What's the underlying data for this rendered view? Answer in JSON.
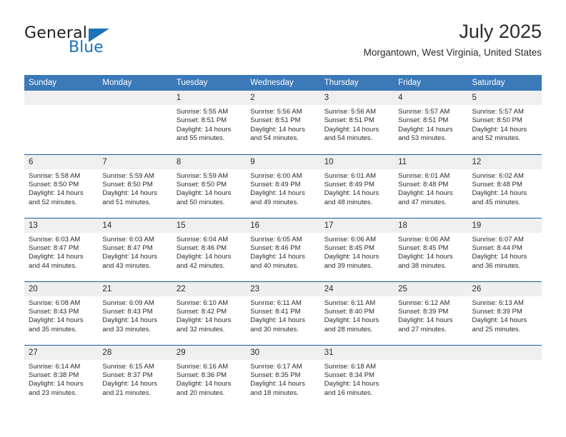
{
  "brand": {
    "name_part1": "General",
    "name_part2": "Blue",
    "triangle_color": "#1b73ba"
  },
  "header": {
    "title": "July 2025",
    "subtitle": "Morgantown, West Virginia, United States"
  },
  "theme": {
    "header_blue": "#3b79b8",
    "row_rule_blue": "#1b5e9e",
    "daynum_band": "#efefef"
  },
  "weekday_headers": [
    "Sunday",
    "Monday",
    "Tuesday",
    "Wednesday",
    "Thursday",
    "Friday",
    "Saturday"
  ],
  "weeks": [
    [
      {
        "day": "",
        "sunrise": "",
        "sunset": "",
        "daylight": "",
        "empty": true
      },
      {
        "day": "",
        "sunrise": "",
        "sunset": "",
        "daylight": "",
        "empty": true
      },
      {
        "day": "1",
        "sunrise": "Sunrise: 5:55 AM",
        "sunset": "Sunset: 8:51 PM",
        "daylight": "Daylight: 14 hours and 55 minutes."
      },
      {
        "day": "2",
        "sunrise": "Sunrise: 5:56 AM",
        "sunset": "Sunset: 8:51 PM",
        "daylight": "Daylight: 14 hours and 54 minutes."
      },
      {
        "day": "3",
        "sunrise": "Sunrise: 5:56 AM",
        "sunset": "Sunset: 8:51 PM",
        "daylight": "Daylight: 14 hours and 54 minutes."
      },
      {
        "day": "4",
        "sunrise": "Sunrise: 5:57 AM",
        "sunset": "Sunset: 8:51 PM",
        "daylight": "Daylight: 14 hours and 53 minutes."
      },
      {
        "day": "5",
        "sunrise": "Sunrise: 5:57 AM",
        "sunset": "Sunset: 8:50 PM",
        "daylight": "Daylight: 14 hours and 52 minutes."
      }
    ],
    [
      {
        "day": "6",
        "sunrise": "Sunrise: 5:58 AM",
        "sunset": "Sunset: 8:50 PM",
        "daylight": "Daylight: 14 hours and 52 minutes."
      },
      {
        "day": "7",
        "sunrise": "Sunrise: 5:59 AM",
        "sunset": "Sunset: 8:50 PM",
        "daylight": "Daylight: 14 hours and 51 minutes."
      },
      {
        "day": "8",
        "sunrise": "Sunrise: 5:59 AM",
        "sunset": "Sunset: 8:50 PM",
        "daylight": "Daylight: 14 hours and 50 minutes."
      },
      {
        "day": "9",
        "sunrise": "Sunrise: 6:00 AM",
        "sunset": "Sunset: 8:49 PM",
        "daylight": "Daylight: 14 hours and 49 minutes."
      },
      {
        "day": "10",
        "sunrise": "Sunrise: 6:01 AM",
        "sunset": "Sunset: 8:49 PM",
        "daylight": "Daylight: 14 hours and 48 minutes."
      },
      {
        "day": "11",
        "sunrise": "Sunrise: 6:01 AM",
        "sunset": "Sunset: 8:48 PM",
        "daylight": "Daylight: 14 hours and 47 minutes."
      },
      {
        "day": "12",
        "sunrise": "Sunrise: 6:02 AM",
        "sunset": "Sunset: 8:48 PM",
        "daylight": "Daylight: 14 hours and 45 minutes."
      }
    ],
    [
      {
        "day": "13",
        "sunrise": "Sunrise: 6:03 AM",
        "sunset": "Sunset: 8:47 PM",
        "daylight": "Daylight: 14 hours and 44 minutes."
      },
      {
        "day": "14",
        "sunrise": "Sunrise: 6:03 AM",
        "sunset": "Sunset: 8:47 PM",
        "daylight": "Daylight: 14 hours and 43 minutes."
      },
      {
        "day": "15",
        "sunrise": "Sunrise: 6:04 AM",
        "sunset": "Sunset: 8:46 PM",
        "daylight": "Daylight: 14 hours and 42 minutes."
      },
      {
        "day": "16",
        "sunrise": "Sunrise: 6:05 AM",
        "sunset": "Sunset: 8:46 PM",
        "daylight": "Daylight: 14 hours and 40 minutes."
      },
      {
        "day": "17",
        "sunrise": "Sunrise: 6:06 AM",
        "sunset": "Sunset: 8:45 PM",
        "daylight": "Daylight: 14 hours and 39 minutes."
      },
      {
        "day": "18",
        "sunrise": "Sunrise: 6:06 AM",
        "sunset": "Sunset: 8:45 PM",
        "daylight": "Daylight: 14 hours and 38 minutes."
      },
      {
        "day": "19",
        "sunrise": "Sunrise: 6:07 AM",
        "sunset": "Sunset: 8:44 PM",
        "daylight": "Daylight: 14 hours and 36 minutes."
      }
    ],
    [
      {
        "day": "20",
        "sunrise": "Sunrise: 6:08 AM",
        "sunset": "Sunset: 8:43 PM",
        "daylight": "Daylight: 14 hours and 35 minutes."
      },
      {
        "day": "21",
        "sunrise": "Sunrise: 6:09 AM",
        "sunset": "Sunset: 8:43 PM",
        "daylight": "Daylight: 14 hours and 33 minutes."
      },
      {
        "day": "22",
        "sunrise": "Sunrise: 6:10 AM",
        "sunset": "Sunset: 8:42 PM",
        "daylight": "Daylight: 14 hours and 32 minutes."
      },
      {
        "day": "23",
        "sunrise": "Sunrise: 6:11 AM",
        "sunset": "Sunset: 8:41 PM",
        "daylight": "Daylight: 14 hours and 30 minutes."
      },
      {
        "day": "24",
        "sunrise": "Sunrise: 6:11 AM",
        "sunset": "Sunset: 8:40 PM",
        "daylight": "Daylight: 14 hours and 28 minutes."
      },
      {
        "day": "25",
        "sunrise": "Sunrise: 6:12 AM",
        "sunset": "Sunset: 8:39 PM",
        "daylight": "Daylight: 14 hours and 27 minutes."
      },
      {
        "day": "26",
        "sunrise": "Sunrise: 6:13 AM",
        "sunset": "Sunset: 8:39 PM",
        "daylight": "Daylight: 14 hours and 25 minutes."
      }
    ],
    [
      {
        "day": "27",
        "sunrise": "Sunrise: 6:14 AM",
        "sunset": "Sunset: 8:38 PM",
        "daylight": "Daylight: 14 hours and 23 minutes."
      },
      {
        "day": "28",
        "sunrise": "Sunrise: 6:15 AM",
        "sunset": "Sunset: 8:37 PM",
        "daylight": "Daylight: 14 hours and 21 minutes."
      },
      {
        "day": "29",
        "sunrise": "Sunrise: 6:16 AM",
        "sunset": "Sunset: 8:36 PM",
        "daylight": "Daylight: 14 hours and 20 minutes."
      },
      {
        "day": "30",
        "sunrise": "Sunrise: 6:17 AM",
        "sunset": "Sunset: 8:35 PM",
        "daylight": "Daylight: 14 hours and 18 minutes."
      },
      {
        "day": "31",
        "sunrise": "Sunrise: 6:18 AM",
        "sunset": "Sunset: 8:34 PM",
        "daylight": "Daylight: 14 hours and 16 minutes."
      },
      {
        "day": "",
        "sunrise": "",
        "sunset": "",
        "daylight": "",
        "empty": true
      },
      {
        "day": "",
        "sunrise": "",
        "sunset": "",
        "daylight": "",
        "empty": true
      }
    ]
  ]
}
